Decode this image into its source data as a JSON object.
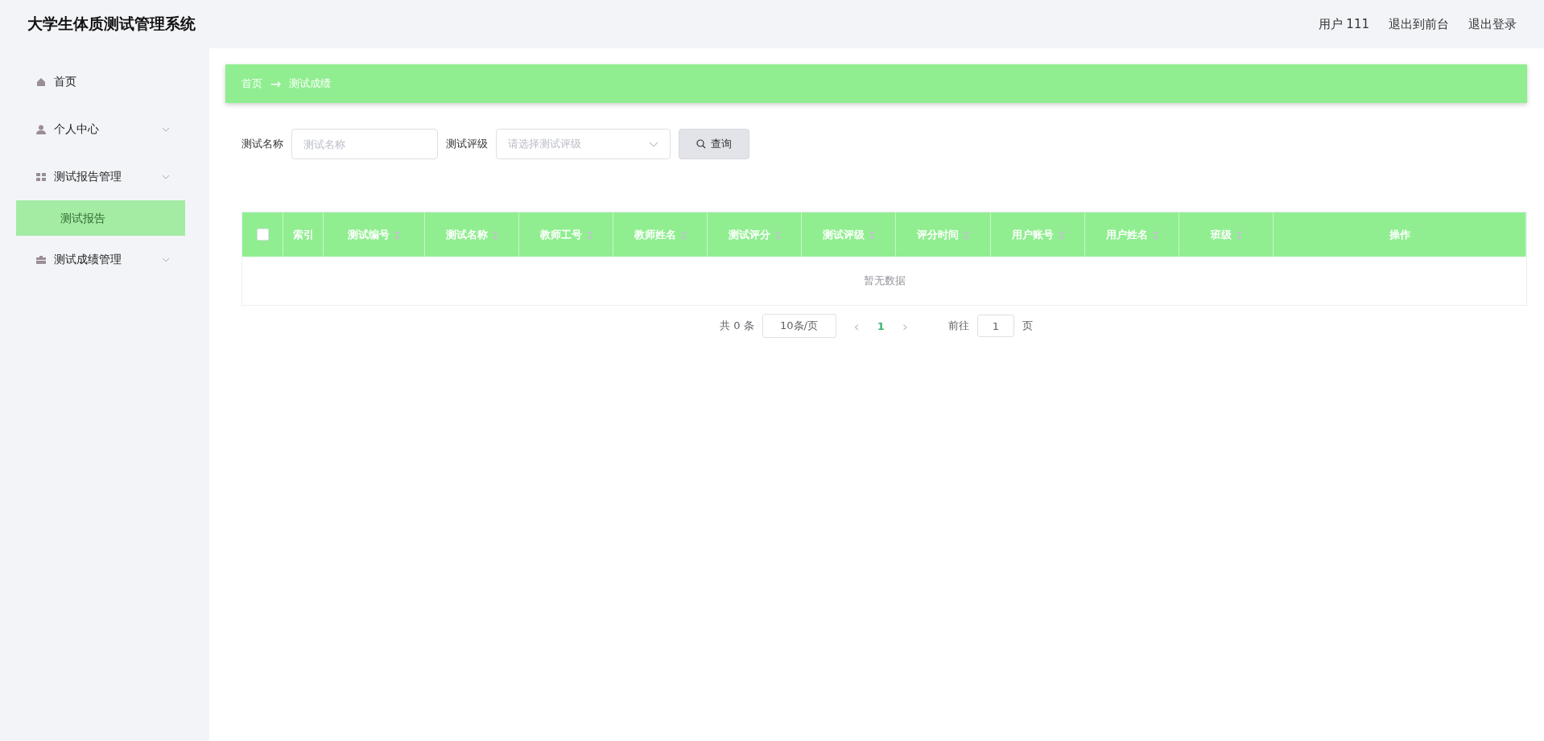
{
  "header": {
    "title": "大学生体质测试管理系统",
    "links": [
      "用户 111",
      "退出到前台",
      "退出登录"
    ]
  },
  "sidebar": {
    "items": [
      {
        "label": "首页",
        "kind": "link"
      },
      {
        "label": "个人中心",
        "kind": "submenu"
      },
      {
        "label": "测试报告管理",
        "kind": "submenu",
        "children": [
          {
            "label": "测试报告",
            "selected": true
          }
        ]
      },
      {
        "label": "测试成绩管理",
        "kind": "submenu"
      }
    ]
  },
  "breadcrumb": [
    "首页",
    "→",
    "测试成绩"
  ],
  "search": {
    "fields": [
      {
        "label": "测试名称",
        "kind": "input",
        "placeholder": "测试名称"
      },
      {
        "label": "测试评级",
        "kind": "select",
        "placeholder": "请选择测试评级"
      }
    ],
    "button": "查询"
  },
  "table": {
    "select_all": {
      "checked": false
    },
    "columns": [
      {
        "label": "索引",
        "sortable": false
      },
      {
        "label": "测试编号",
        "sortable": true
      },
      {
        "label": "测试名称",
        "sortable": true
      },
      {
        "label": "教师工号",
        "sortable": true
      },
      {
        "label": "教师姓名",
        "sortable": true
      },
      {
        "label": "测试评分",
        "sortable": true
      },
      {
        "label": "测试评级",
        "sortable": true
      },
      {
        "label": "评分时间",
        "sortable": true
      },
      {
        "label": "用户账号",
        "sortable": true
      },
      {
        "label": "用户姓名",
        "sortable": true
      },
      {
        "label": "班级",
        "sortable": true
      },
      {
        "label": "操作",
        "sortable": false
      }
    ],
    "empty_text": "暂无数据"
  },
  "pagination": {
    "total": "共 0 条",
    "page_size": "10条/页",
    "prev": "‹",
    "pages": [
      {
        "label": "1",
        "selected": true
      }
    ],
    "next": "›",
    "goto_label": "前往",
    "goto_value": "1",
    "goto_suffix": "页"
  }
}
